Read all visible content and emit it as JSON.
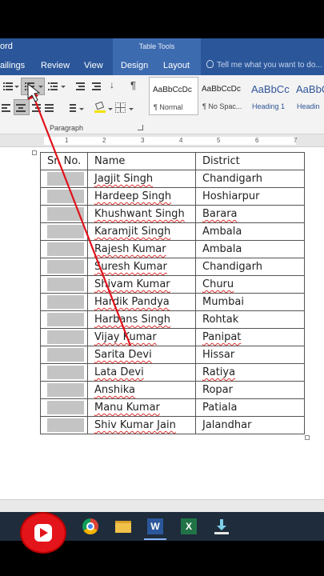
{
  "window": {
    "app_title": "ord"
  },
  "contextual_group": {
    "label": "Table Tools"
  },
  "tabs": [
    {
      "label": "ailings"
    },
    {
      "label": "Review"
    },
    {
      "label": "View"
    },
    {
      "label": "Design"
    },
    {
      "label": "Layout"
    }
  ],
  "tell_me": {
    "placeholder": "Tell me what you want to do..."
  },
  "ribbon": {
    "paragraph_group_label": "Paragraph",
    "styles": [
      {
        "sample": "AaBbCcDc",
        "name": "¶ Normal"
      },
      {
        "sample": "AaBbCcDc",
        "name": "¶ No Spac..."
      },
      {
        "sample": "AaBbCc",
        "name": "Heading 1"
      },
      {
        "sample": "AaBbC",
        "name": "Headin"
      }
    ]
  },
  "ruler": {
    "numbers": [
      "1",
      "2",
      "3",
      "4",
      "5",
      "6",
      "7"
    ]
  },
  "table": {
    "headers": [
      "Sr. No.",
      "Name",
      "District"
    ],
    "rows": [
      {
        "name": "Jagjit Singh",
        "district": "Chandigarh"
      },
      {
        "name": "Hardeep Singh",
        "district": "Hoshiarpur"
      },
      {
        "name": "Khushwant Singh",
        "district": "Barara"
      },
      {
        "name": "Karamjit Singh",
        "district": "Ambala"
      },
      {
        "name": "Rajesh Kumar",
        "district": "Ambala"
      },
      {
        "name": "Suresh Kumar",
        "district": "Chandigarh"
      },
      {
        "name": "Shivam Kumar",
        "district": "Churu"
      },
      {
        "name": "Hardik Pandya",
        "district": "Mumbai"
      },
      {
        "name": "Harbans Singh",
        "district": "Rohtak"
      },
      {
        "name": "Vijay Kumar",
        "district": "Panipat"
      },
      {
        "name": "Sarita Devi",
        "district": "Hissar"
      },
      {
        "name": "Lata Devi",
        "district": "Ratiya"
      },
      {
        "name": "Anshika",
        "district": "Ropar"
      },
      {
        "name": "Manu Kumar",
        "district": "Patiala"
      },
      {
        "name": "Shiv Kumar Jain",
        "district": "Jalandhar"
      }
    ]
  },
  "taskbar": {
    "icons": [
      "youtube-icon",
      "chrome-icon",
      "file-explorer-icon",
      "word-icon",
      "excel-icon",
      "download-icon"
    ],
    "word_label": "W",
    "excel_label": "X"
  },
  "colors": {
    "word_blue": "#2b579a",
    "selection_grey": "#c4c4c4",
    "annotation_red": "#e0121a",
    "spellcheck_red": "#e03030"
  }
}
